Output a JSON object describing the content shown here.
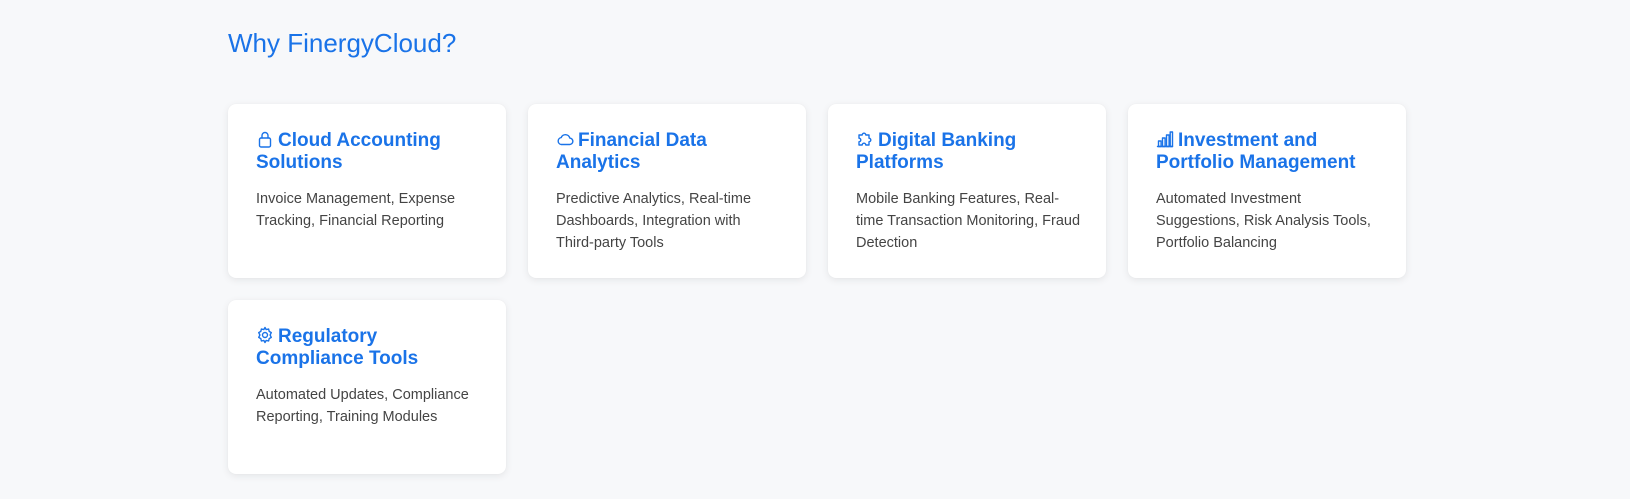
{
  "section": {
    "title": "Why FinergyCloud?"
  },
  "colors": {
    "accent": "#1a73e8",
    "background": "#f7f8fa",
    "card": "#ffffff",
    "text": "#444444"
  },
  "features": [
    {
      "icon": "lock-icon",
      "title": "Cloud Accounting Solutions",
      "description": "Invoice Management, Expense Tracking, Financial Reporting"
    },
    {
      "icon": "cloud-icon",
      "title": "Financial Data Analytics",
      "description": "Predictive Analytics, Real-time Dashboards, Integration with Third-party Tools"
    },
    {
      "icon": "puzzle-icon",
      "title": "Digital Banking Platforms",
      "description": "Mobile Banking Features, Real-time Transaction Monitoring, Fraud Detection"
    },
    {
      "icon": "bar-chart-icon",
      "title": "Investment and Portfolio Management",
      "description": "Automated Investment Suggestions, Risk Analysis Tools, Portfolio Balancing"
    },
    {
      "icon": "gear-icon",
      "title": "Regulatory Compliance Tools",
      "description": "Automated Updates, Compliance Reporting, Training Modules"
    }
  ]
}
